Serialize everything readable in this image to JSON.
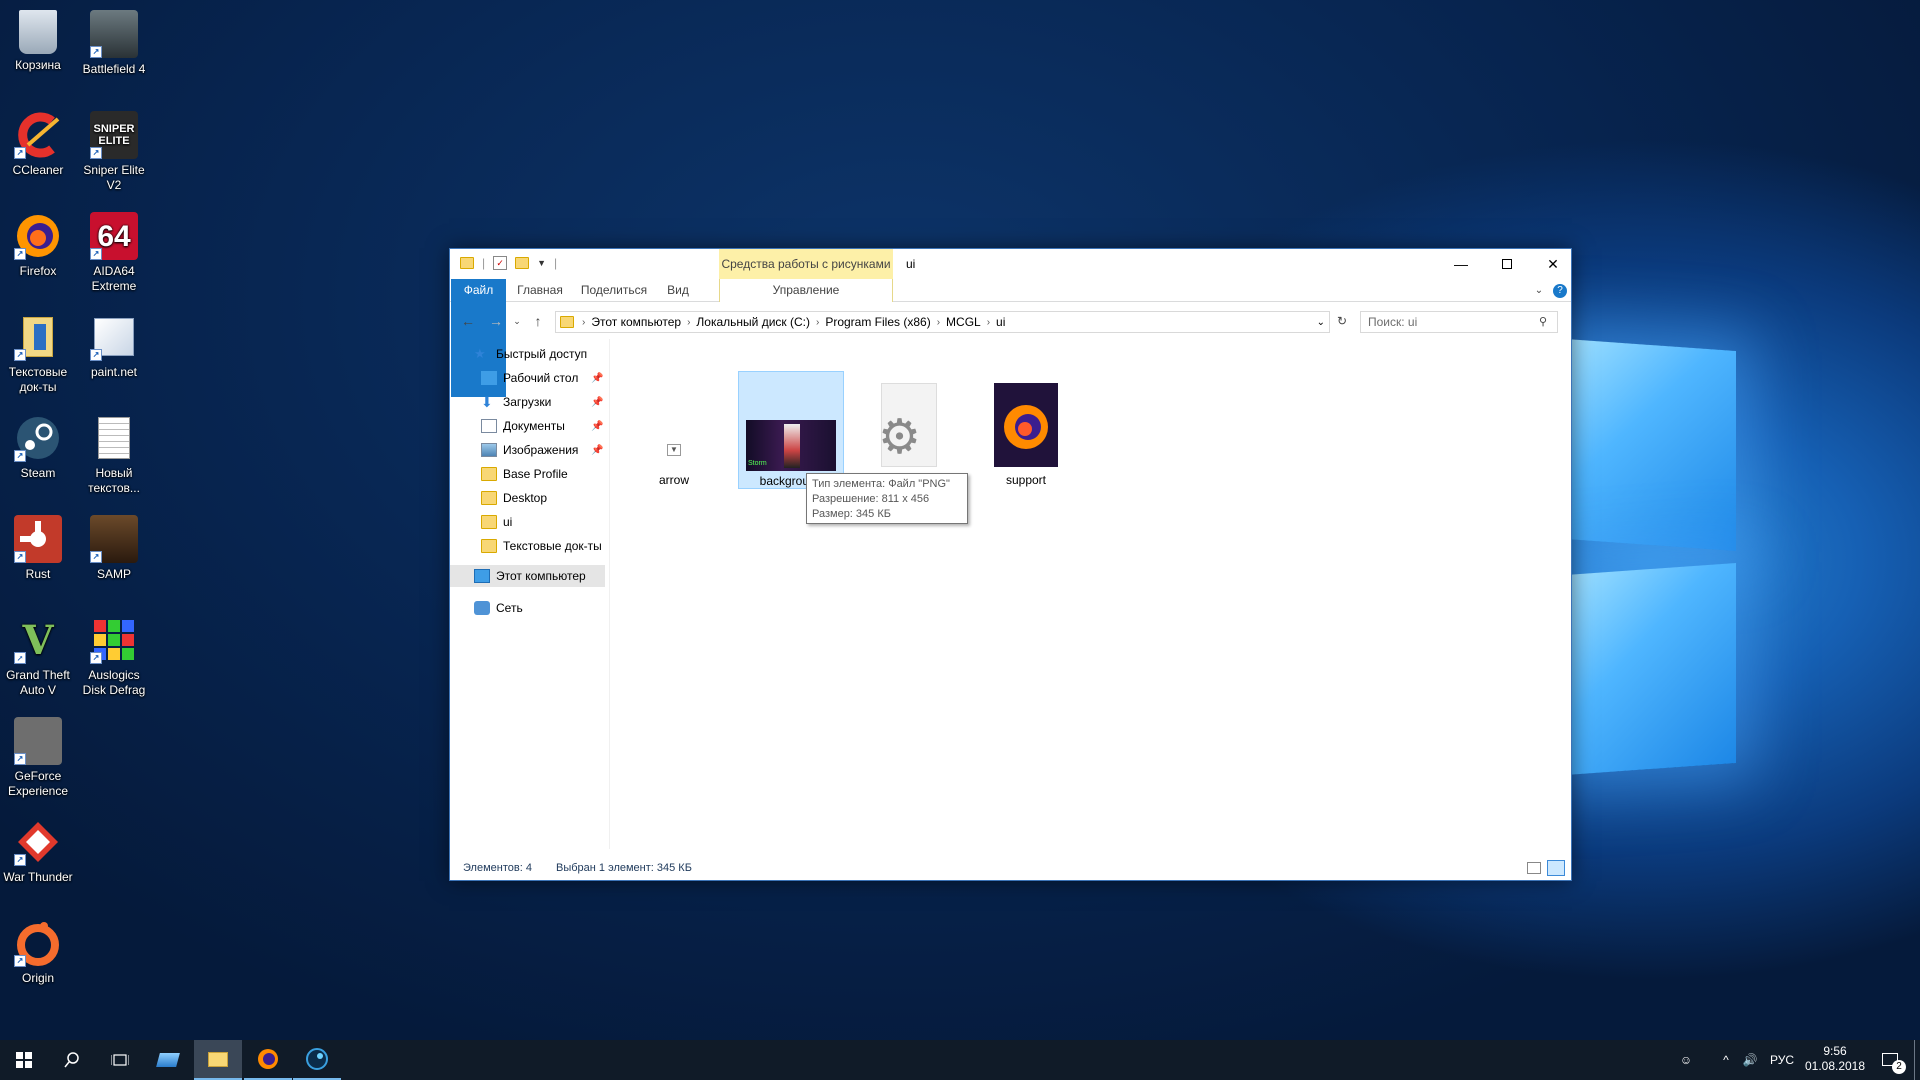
{
  "desktop": {
    "icons": [
      {
        "label": "Корзина",
        "icon": "recycle-bin-icon"
      },
      {
        "label": "Battlefield 4",
        "icon": "battlefield-icon"
      },
      {
        "label": "CCleaner",
        "icon": "ccleaner-icon"
      },
      {
        "label": "Sniper Elite V2",
        "icon": "sniper-elite-icon"
      },
      {
        "label": "Firefox",
        "icon": "firefox-icon"
      },
      {
        "label": "AIDA64 Extreme",
        "icon": "aida64-icon"
      },
      {
        "label": "Текстовые док-ты",
        "icon": "folder-docs-icon"
      },
      {
        "label": "paint.net",
        "icon": "paintnet-icon"
      },
      {
        "label": "Steam",
        "icon": "steam-icon"
      },
      {
        "label": "Новый текстов...",
        "icon": "text-file-icon"
      },
      {
        "label": "Rust",
        "icon": "rust-icon"
      },
      {
        "label": "SAMP",
        "icon": "samp-icon"
      },
      {
        "label": "Grand Theft Auto V",
        "icon": "gta-v-icon"
      },
      {
        "label": "Auslogics Disk Defrag",
        "icon": "defrag-icon"
      },
      {
        "label": "GeForce Experience",
        "icon": "geforce-icon"
      },
      {
        "label": "War Thunder",
        "icon": "war-thunder-icon"
      },
      {
        "label": "Origin",
        "icon": "origin-icon"
      }
    ],
    "aida_text": "64",
    "sniper_text": "SNIPER ELITE"
  },
  "explorer": {
    "context_tab": "Средства работы с рисунками",
    "title": "ui",
    "tabs": {
      "file": "Файл",
      "home": "Главная",
      "share": "Поделиться",
      "view": "Вид",
      "manage": "Управление"
    },
    "address": [
      "Этот компьютер",
      "Локальный диск (C:)",
      "Program Files (x86)",
      "MCGL",
      "ui"
    ],
    "search_placeholder": "Поиск: ui",
    "nav": {
      "quick_access": "Быстрый доступ",
      "items": [
        "Рабочий стол",
        "Загрузки",
        "Документы",
        "Изображения",
        "Base Profile",
        "Desktop",
        "ui",
        "Текстовые док-ты"
      ],
      "this_pc": "Этот компьютер",
      "network": "Сеть"
    },
    "files": [
      {
        "name": "arrow"
      },
      {
        "name": "background",
        "thumb_text": "Storm"
      },
      {
        "name": "style"
      },
      {
        "name": "support"
      }
    ],
    "tooltip": {
      "line1": "Тип элемента: Файл \"PNG\"",
      "line2": "Разрешение: 811 x 456",
      "line3": "Размер: 345 КБ"
    },
    "status": {
      "count": "Элементов: 4",
      "selected": "Выбран 1 элемент: 345 КБ"
    }
  },
  "taskbar": {
    "lang": "РУС",
    "time": "9:56",
    "date": "01.08.2018",
    "notifications": "2"
  },
  "colors": {
    "accent": "#1979ca",
    "selection": "#cce8ff",
    "context_tab": "#fdf0a8",
    "taskbar": "#101b28"
  }
}
